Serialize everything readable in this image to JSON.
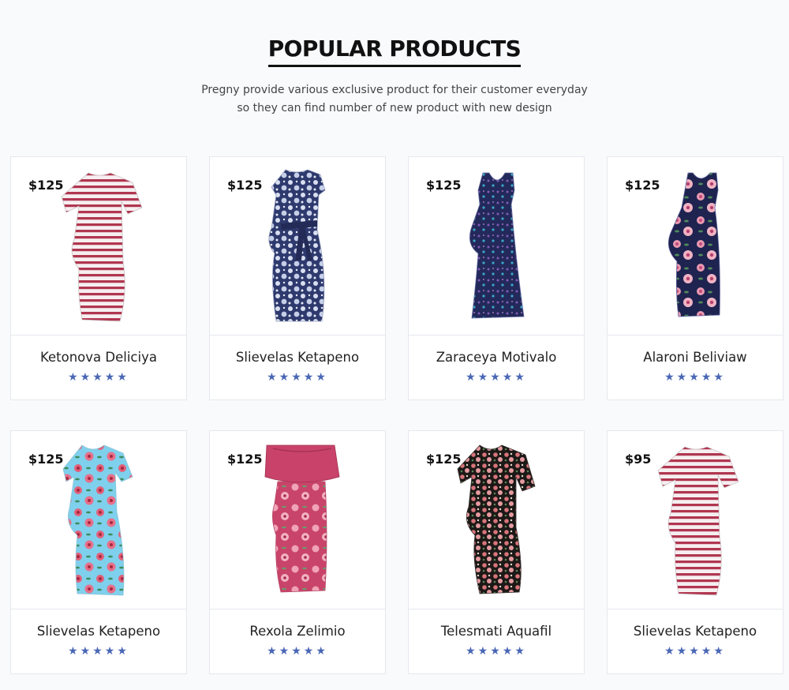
{
  "section": {
    "title": "POPULAR PRODUCTS",
    "subtitle_line1": "Pregny provide various exclusive product for their customer everyday",
    "subtitle_line2": "so they can find number of new product with new design"
  },
  "products": [
    {
      "price": "$125",
      "name": "Ketonova Deliciya",
      "stars": "★★★★★",
      "rating": 5,
      "image": "striped-dress"
    },
    {
      "price": "$125",
      "name": "Slievelas Ketapeno",
      "stars": "★★★★★",
      "rating": 5,
      "image": "navy-paisley-dress"
    },
    {
      "price": "$125",
      "name": "Zaraceya Motivalo",
      "stars": "★★★★★",
      "rating": 5,
      "image": "navy-sleeveless-dress"
    },
    {
      "price": "$125",
      "name": "Alaroni Beliviaw",
      "stars": "★★★★★",
      "rating": 5,
      "image": "navy-floral-dress"
    },
    {
      "price": "$125",
      "name": "Slievelas Ketapeno",
      "stars": "★★★★★",
      "rating": 5,
      "image": "light-blue-floral-dress"
    },
    {
      "price": "$125",
      "name": "Rexola Zelimio",
      "stars": "★★★★★",
      "rating": 5,
      "image": "pink-ruffle-dress"
    },
    {
      "price": "$125",
      "name": "Telesmati Aquafil",
      "stars": "★★★★★",
      "rating": 5,
      "image": "dark-floral-dress"
    },
    {
      "price": "$95",
      "name": "Slievelas Ketapeno",
      "stars": "★★★★★",
      "rating": 5,
      "image": "striped-dress"
    }
  ],
  "colors": {
    "star": "#4a67b5",
    "background": "#f9fafc",
    "card_border": "#e6e8ee"
  }
}
